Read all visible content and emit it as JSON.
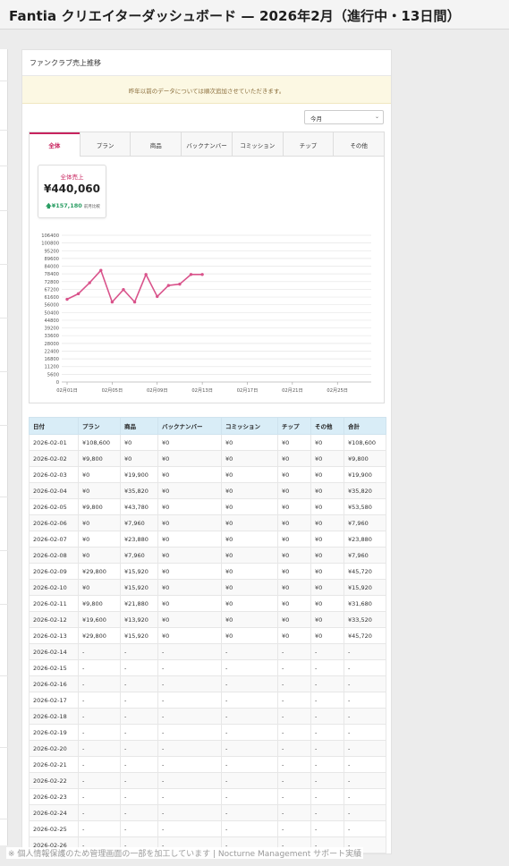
{
  "page": {
    "title": "Fantia クリエイターダッシュボード — 2026年2月（進行中・13日間）"
  },
  "card": {
    "header": "ファンクラブ売上推移",
    "notice": "昨年以前のデータについては順次追加させていただきます。",
    "period_select": "今月"
  },
  "tabs": [
    {
      "label": "全体",
      "active": true
    },
    {
      "label": "プラン",
      "active": false
    },
    {
      "label": "商品",
      "active": false
    },
    {
      "label": "バックナンバー",
      "active": false
    },
    {
      "label": "コミッション",
      "active": false
    },
    {
      "label": "チップ",
      "active": false
    },
    {
      "label": "その他",
      "active": false
    }
  ],
  "kpi": {
    "title": "全体売上",
    "value": "¥440,060",
    "diff": "¥157,180",
    "diff_label": "前月比較",
    "diff_icon": "arrow-up-icon"
  },
  "colors": {
    "accent": "#c8245f",
    "line": "#d9538b",
    "positive": "#2a9d63",
    "table_header": "#d9edf7",
    "notice_bg": "#fcf8e3"
  },
  "chart_data": {
    "type": "line",
    "xlabel": "",
    "ylabel": "",
    "ylim": [
      0,
      106400
    ],
    "yticks": [
      0,
      5600,
      11200,
      16800,
      22400,
      28000,
      33600,
      39200,
      44800,
      50400,
      56000,
      61600,
      67200,
      72800,
      78400,
      84000,
      89600,
      95200,
      100800,
      106400
    ],
    "x_tick_labels": [
      "02月01日",
      "02月05日",
      "02月09日",
      "02月13日",
      "02月17日",
      "02月21日",
      "02月25日"
    ],
    "x_tick_days": [
      1,
      5,
      9,
      13,
      17,
      21,
      25
    ],
    "x_range_days": [
      1,
      28
    ],
    "grid": true,
    "series": [
      {
        "days": [
          1,
          2,
          3,
          4,
          5,
          6,
          7,
          8,
          9,
          10,
          11,
          12,
          13
        ],
        "values": [
          60000,
          64000,
          72000,
          81000,
          58000,
          67000,
          58000,
          78000,
          62000,
          70000,
          71000,
          78000,
          78000
        ]
      }
    ]
  },
  "table": {
    "columns": [
      "日付",
      "プラン",
      "商品",
      "バックナンバー",
      "コミッション",
      "チップ",
      "その他",
      "合計"
    ],
    "rows": [
      [
        "2026-02-01",
        "¥108,600",
        "¥0",
        "¥0",
        "¥0",
        "¥0",
        "¥0",
        "¥108,600"
      ],
      [
        "2026-02-02",
        "¥9,800",
        "¥0",
        "¥0",
        "¥0",
        "¥0",
        "¥0",
        "¥9,800"
      ],
      [
        "2026-02-03",
        "¥0",
        "¥19,900",
        "¥0",
        "¥0",
        "¥0",
        "¥0",
        "¥19,900"
      ],
      [
        "2026-02-04",
        "¥0",
        "¥35,820",
        "¥0",
        "¥0",
        "¥0",
        "¥0",
        "¥35,820"
      ],
      [
        "2026-02-05",
        "¥9,800",
        "¥43,780",
        "¥0",
        "¥0",
        "¥0",
        "¥0",
        "¥53,580"
      ],
      [
        "2026-02-06",
        "¥0",
        "¥7,960",
        "¥0",
        "¥0",
        "¥0",
        "¥0",
        "¥7,960"
      ],
      [
        "2026-02-07",
        "¥0",
        "¥23,880",
        "¥0",
        "¥0",
        "¥0",
        "¥0",
        "¥23,880"
      ],
      [
        "2026-02-08",
        "¥0",
        "¥7,960",
        "¥0",
        "¥0",
        "¥0",
        "¥0",
        "¥7,960"
      ],
      [
        "2026-02-09",
        "¥29,800",
        "¥15,920",
        "¥0",
        "¥0",
        "¥0",
        "¥0",
        "¥45,720"
      ],
      [
        "2026-02-10",
        "¥0",
        "¥15,920",
        "¥0",
        "¥0",
        "¥0",
        "¥0",
        "¥15,920"
      ],
      [
        "2026-02-11",
        "¥9,800",
        "¥21,880",
        "¥0",
        "¥0",
        "¥0",
        "¥0",
        "¥31,680"
      ],
      [
        "2026-02-12",
        "¥19,600",
        "¥13,920",
        "¥0",
        "¥0",
        "¥0",
        "¥0",
        "¥33,520"
      ],
      [
        "2026-02-13",
        "¥29,800",
        "¥15,920",
        "¥0",
        "¥0",
        "¥0",
        "¥0",
        "¥45,720"
      ],
      [
        "2026-02-14",
        "-",
        "-",
        "-",
        "-",
        "-",
        "-",
        "-"
      ],
      [
        "2026-02-15",
        "-",
        "-",
        "-",
        "-",
        "-",
        "-",
        "-"
      ],
      [
        "2026-02-16",
        "-",
        "-",
        "-",
        "-",
        "-",
        "-",
        "-"
      ],
      [
        "2026-02-17",
        "-",
        "-",
        "-",
        "-",
        "-",
        "-",
        "-"
      ],
      [
        "2026-02-18",
        "-",
        "-",
        "-",
        "-",
        "-",
        "-",
        "-"
      ],
      [
        "2026-02-19",
        "-",
        "-",
        "-",
        "-",
        "-",
        "-",
        "-"
      ],
      [
        "2026-02-20",
        "-",
        "-",
        "-",
        "-",
        "-",
        "-",
        "-"
      ],
      [
        "2026-02-21",
        "-",
        "-",
        "-",
        "-",
        "-",
        "-",
        "-"
      ],
      [
        "2026-02-22",
        "-",
        "-",
        "-",
        "-",
        "-",
        "-",
        "-"
      ],
      [
        "2026-02-23",
        "-",
        "-",
        "-",
        "-",
        "-",
        "-",
        "-"
      ],
      [
        "2026-02-24",
        "-",
        "-",
        "-",
        "-",
        "-",
        "-",
        "-"
      ],
      [
        "2026-02-25",
        "-",
        "-",
        "-",
        "-",
        "-",
        "-",
        "-"
      ],
      [
        "2026-02-26",
        "-",
        "-",
        "-",
        "-",
        "-",
        "-",
        "-"
      ]
    ]
  },
  "footer": {
    "note": "※ 個人情報保護のため管理画面の一部を加工しています | Nocturne Management サポート実績"
  }
}
